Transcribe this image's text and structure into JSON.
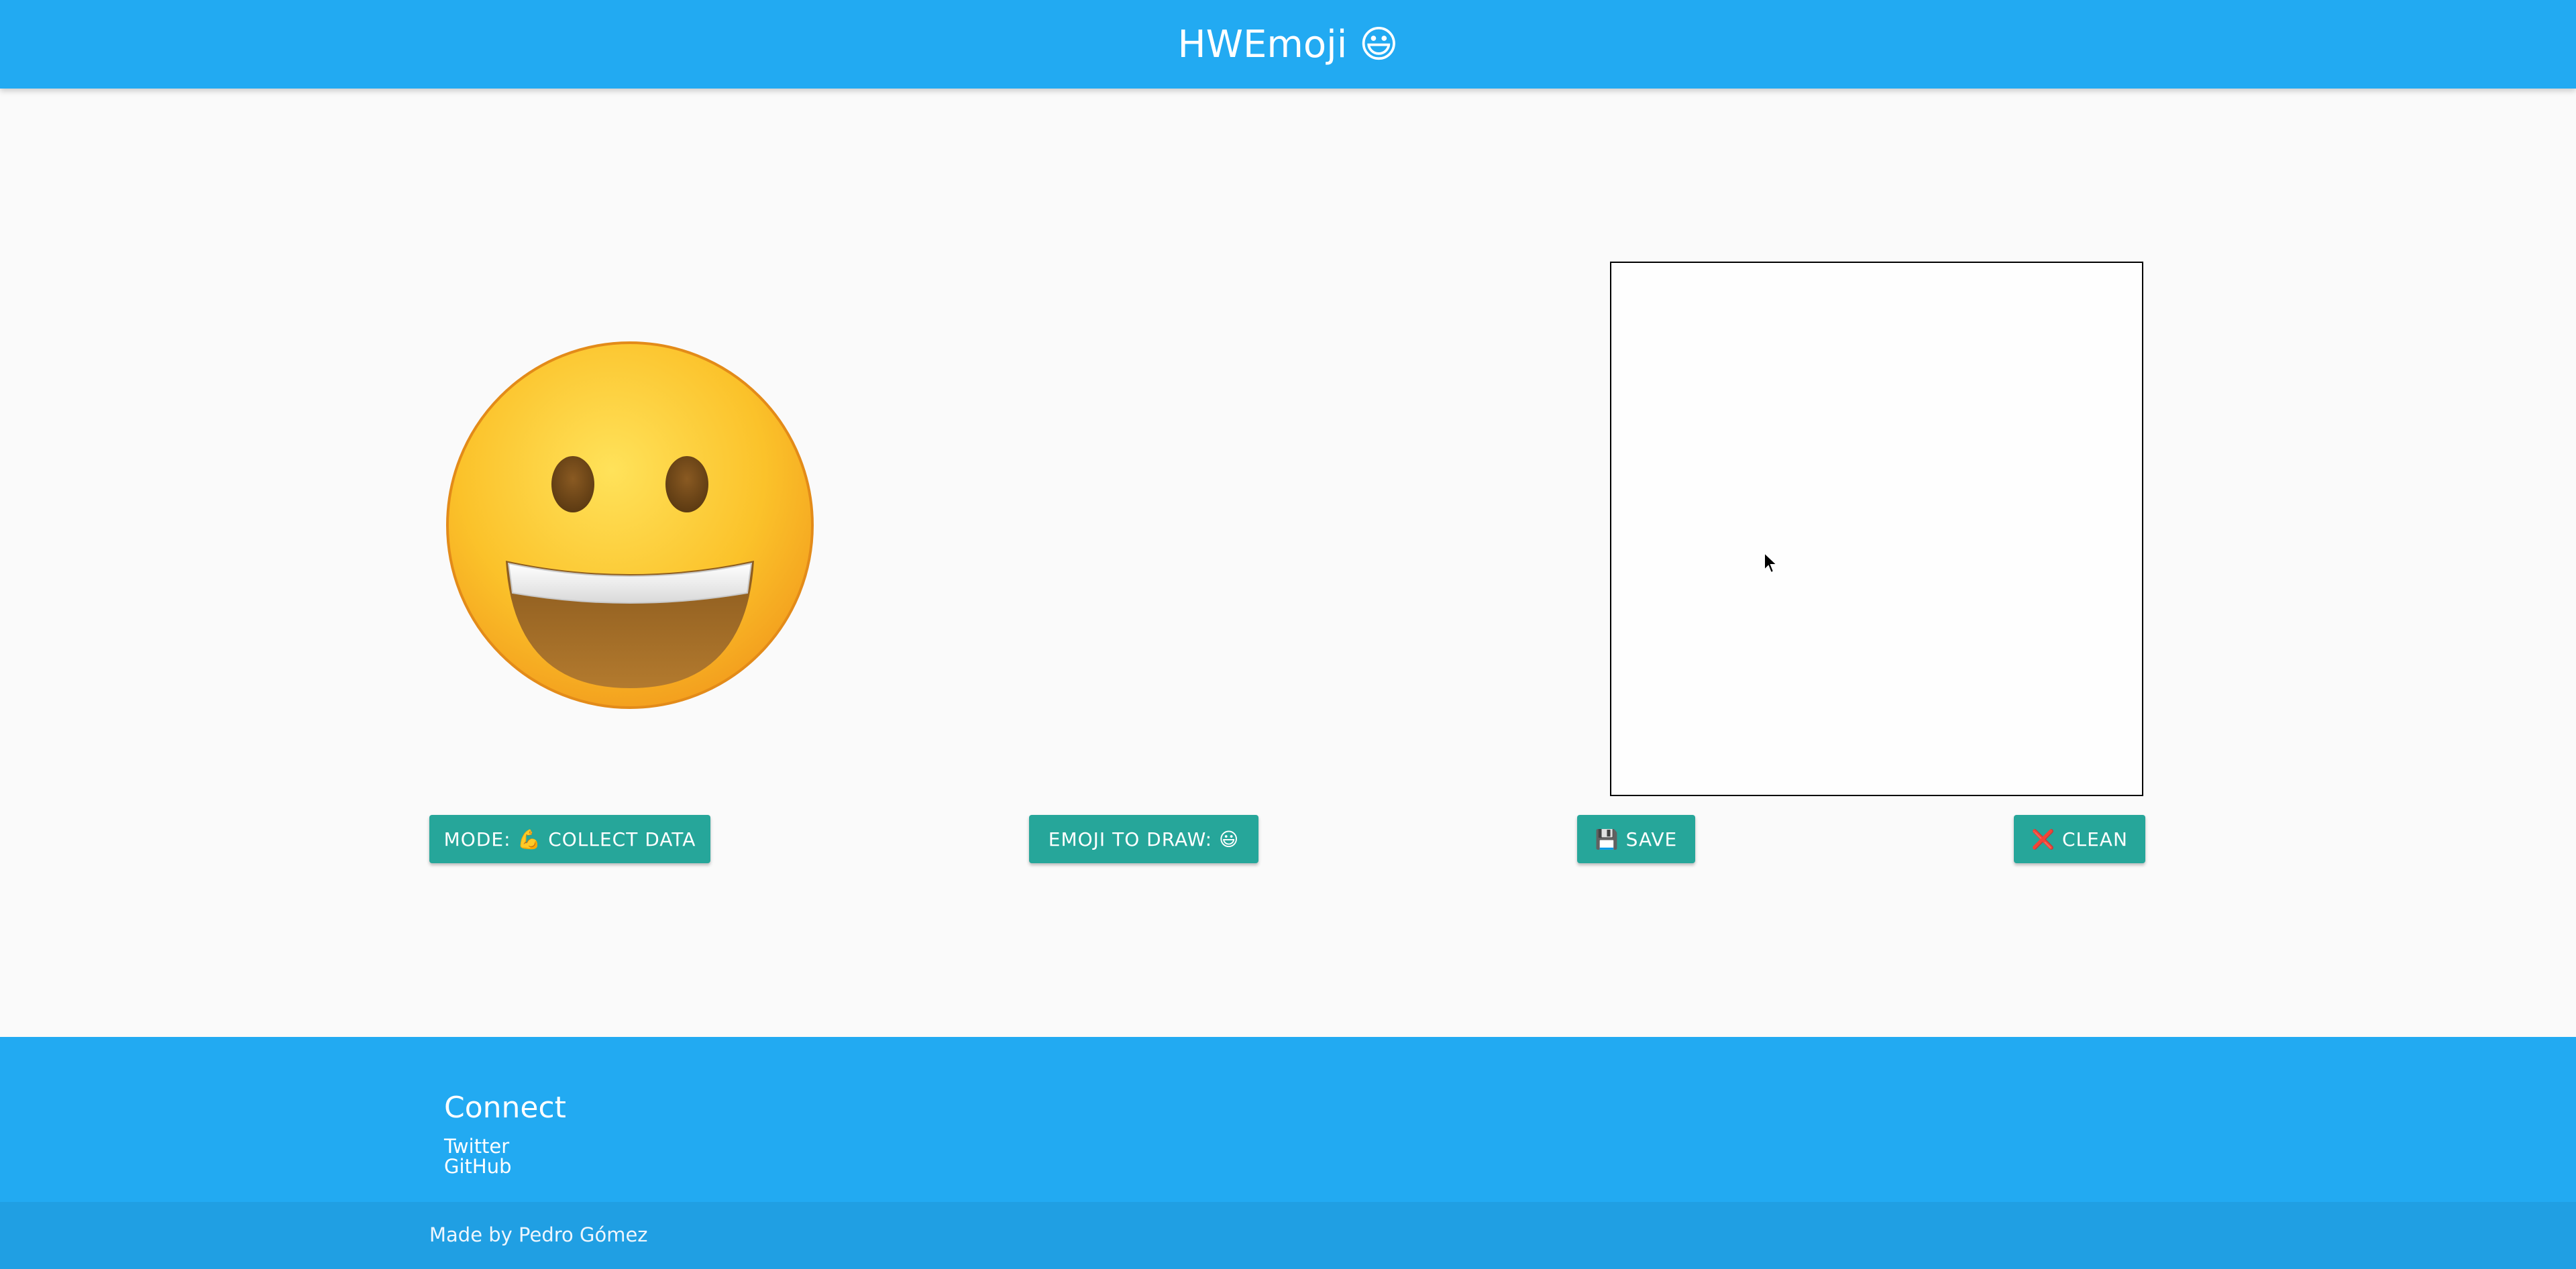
{
  "header": {
    "brand": "HWEmoji 😃"
  },
  "main": {
    "emoji_preview_icon": "grinning-face-big-eyes",
    "buttons": {
      "mode_label": "MODE: 💪 COLLECT DATA",
      "emoji_to_draw_label": "EMOJI TO DRAW: 😃",
      "save_icon": "💾",
      "save_label": "SAVE",
      "clean_icon": "❌",
      "clean_label": "CLEAN"
    }
  },
  "footer": {
    "title": "Connect",
    "links": [
      "Twitter",
      "GitHub"
    ],
    "copyright": "Made by Pedro Gómez"
  },
  "colors": {
    "primary": "#22aaf2",
    "button": "#26a69a",
    "copyright_bg": "#209fe3"
  }
}
